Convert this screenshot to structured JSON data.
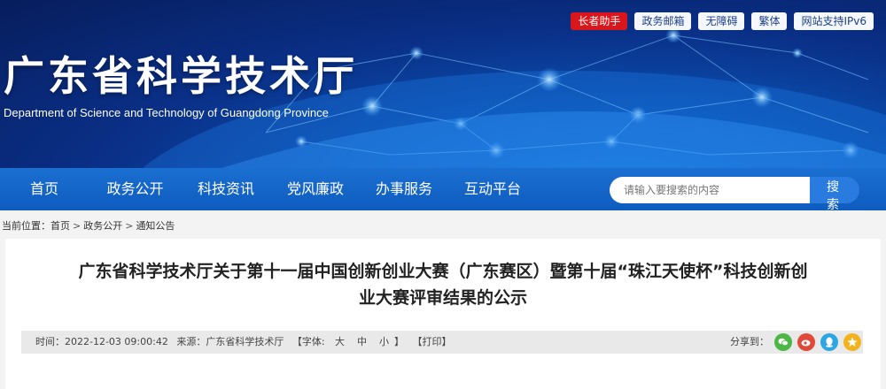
{
  "top_links": {
    "elder": "长者助手",
    "mail": "政务邮箱",
    "accessibility": "无障碍",
    "traditional": "繁体",
    "ipv6": "网站支持IPv6"
  },
  "site": {
    "title": "广东省科学技术厅",
    "subtitle": "Department of Science and Technology of Guangdong Province"
  },
  "nav": {
    "items": [
      "首页",
      "政务公开",
      "科技资讯",
      "党风廉政",
      "办事服务",
      "互动平台"
    ]
  },
  "search": {
    "placeholder": "请输入要搜索的内容",
    "button": "搜 索"
  },
  "breadcrumb": {
    "prefix": "当前位置：",
    "items": [
      "首页",
      "政务公开",
      "通知公告"
    ],
    "sep": ">"
  },
  "article": {
    "title_line1": "广东省科学技术厅关于第十一届中国创新创业大赛（广东赛区）暨第十届“珠江天使杯”科技创新创",
    "title_line2": "业大赛评审结果的公示",
    "time": "时间：2022-12-03 09:00:42",
    "source": "来源：广东省科学技术厅",
    "font_label": "【字体:",
    "font_large": "大",
    "font_medium": "中",
    "font_small": "小",
    "font_close": "】",
    "print": "【打印】",
    "share_label": "分享到：",
    "share_icons": [
      "wechat-icon",
      "weibo-icon",
      "qq-icon",
      "qzone-icon"
    ],
    "share_colors": [
      "#4cb646",
      "#e0493a",
      "#2fa6e4",
      "#f3b31e"
    ]
  }
}
